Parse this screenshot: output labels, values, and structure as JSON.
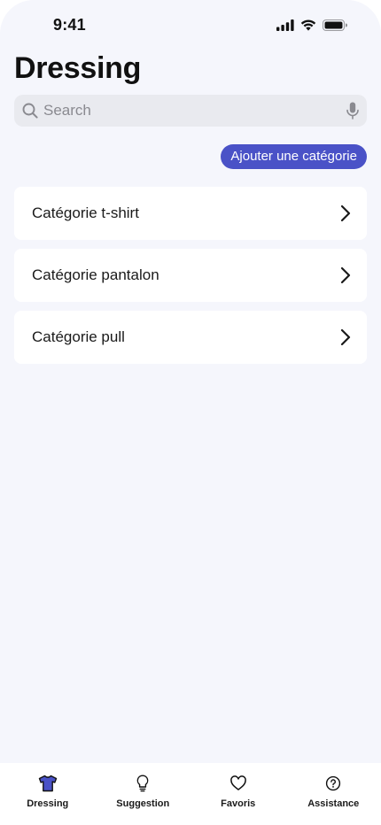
{
  "status_bar": {
    "time": "9:41"
  },
  "header": {
    "title": "Dressing"
  },
  "search": {
    "placeholder": "Search",
    "value": ""
  },
  "actions": {
    "add_category_label": "Ajouter une catégorie"
  },
  "categories": [
    {
      "label": "Catégorie t-shirt"
    },
    {
      "label": "Catégorie pantalon"
    },
    {
      "label": "Catégorie pull"
    }
  ],
  "tab_bar": {
    "items": [
      {
        "label": "Dressing",
        "icon": "tshirt-icon",
        "active": true
      },
      {
        "label": "Suggestion",
        "icon": "lightbulb-icon",
        "active": false
      },
      {
        "label": "Favoris",
        "icon": "heart-icon",
        "active": false
      },
      {
        "label": "Assistance",
        "icon": "help-circle-icon",
        "active": false
      }
    ]
  },
  "colors": {
    "accent": "#4a52c7",
    "background": "#f5f6fc",
    "card": "#ffffff",
    "search_field": "#e9eaef"
  }
}
